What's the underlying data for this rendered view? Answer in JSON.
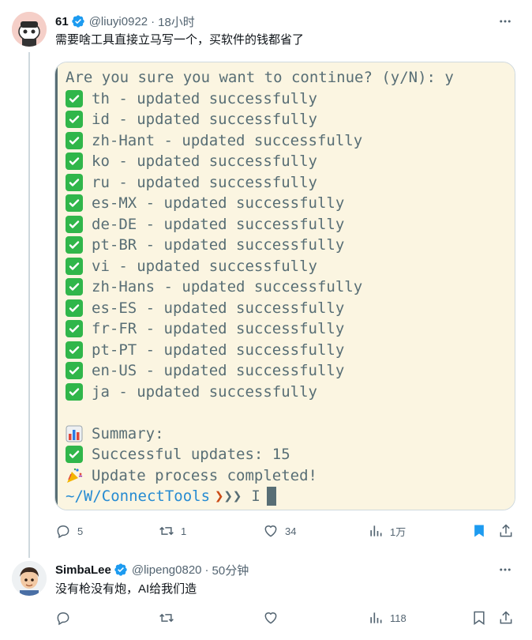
{
  "tweets": [
    {
      "name": "61",
      "handle": "@liuyi0922",
      "time": "18小时",
      "text": "需要啥工具直接立马写一个，买软件的钱都省了",
      "actions": {
        "replies": "5",
        "retweets": "1",
        "likes": "34",
        "views": "1万"
      }
    },
    {
      "name": "SimbaLee",
      "handle": "@lipeng0820",
      "time": "50分钟",
      "text": "没有枪没有炮，AI给我们造",
      "actions": {
        "replies": "",
        "retweets": "",
        "likes": "",
        "views": "118"
      }
    }
  ],
  "terminal": {
    "question": "Are you sure you want to continue? (y/N): y",
    "updates": [
      "th - updated successfully",
      "id - updated successfully",
      "zh-Hant - updated successfully",
      "ko - updated successfully",
      "ru - updated successfully",
      "es-MX - updated successfully",
      "de-DE - updated successfully",
      "pt-BR - updated successfully",
      "vi - updated successfully",
      "zh-Hans - updated successfully",
      "es-ES - updated successfully",
      "fr-FR - updated successfully",
      "pt-PT - updated successfully",
      "en-US - updated successfully",
      "ja - updated successfully"
    ],
    "summary_label": "Summary:",
    "successful_updates": "Successful updates: 15",
    "completed": "Update process completed!",
    "prompt_path": "~/W/ConnectTools",
    "prompt_arrow": "❯",
    "prompt_arrows_rest": "❯❯",
    "prompt_input": "I"
  },
  "colors": {
    "verified": "#1d9bf0",
    "bookmark_active": "#1d9bf0",
    "check": "#30b64a",
    "terminal_bg": "#fbf5e1",
    "terminal_text": "#586e75",
    "prompt_path": "#268bd2",
    "prompt_arrow": "#cb4b16"
  },
  "icons": [
    "verified-badge-icon",
    "more-icon",
    "reply-icon",
    "retweet-icon",
    "like-icon",
    "views-icon",
    "bookmark-icon",
    "share-icon",
    "check-mark-icon",
    "bar-chart-icon",
    "party-popper-icon"
  ]
}
